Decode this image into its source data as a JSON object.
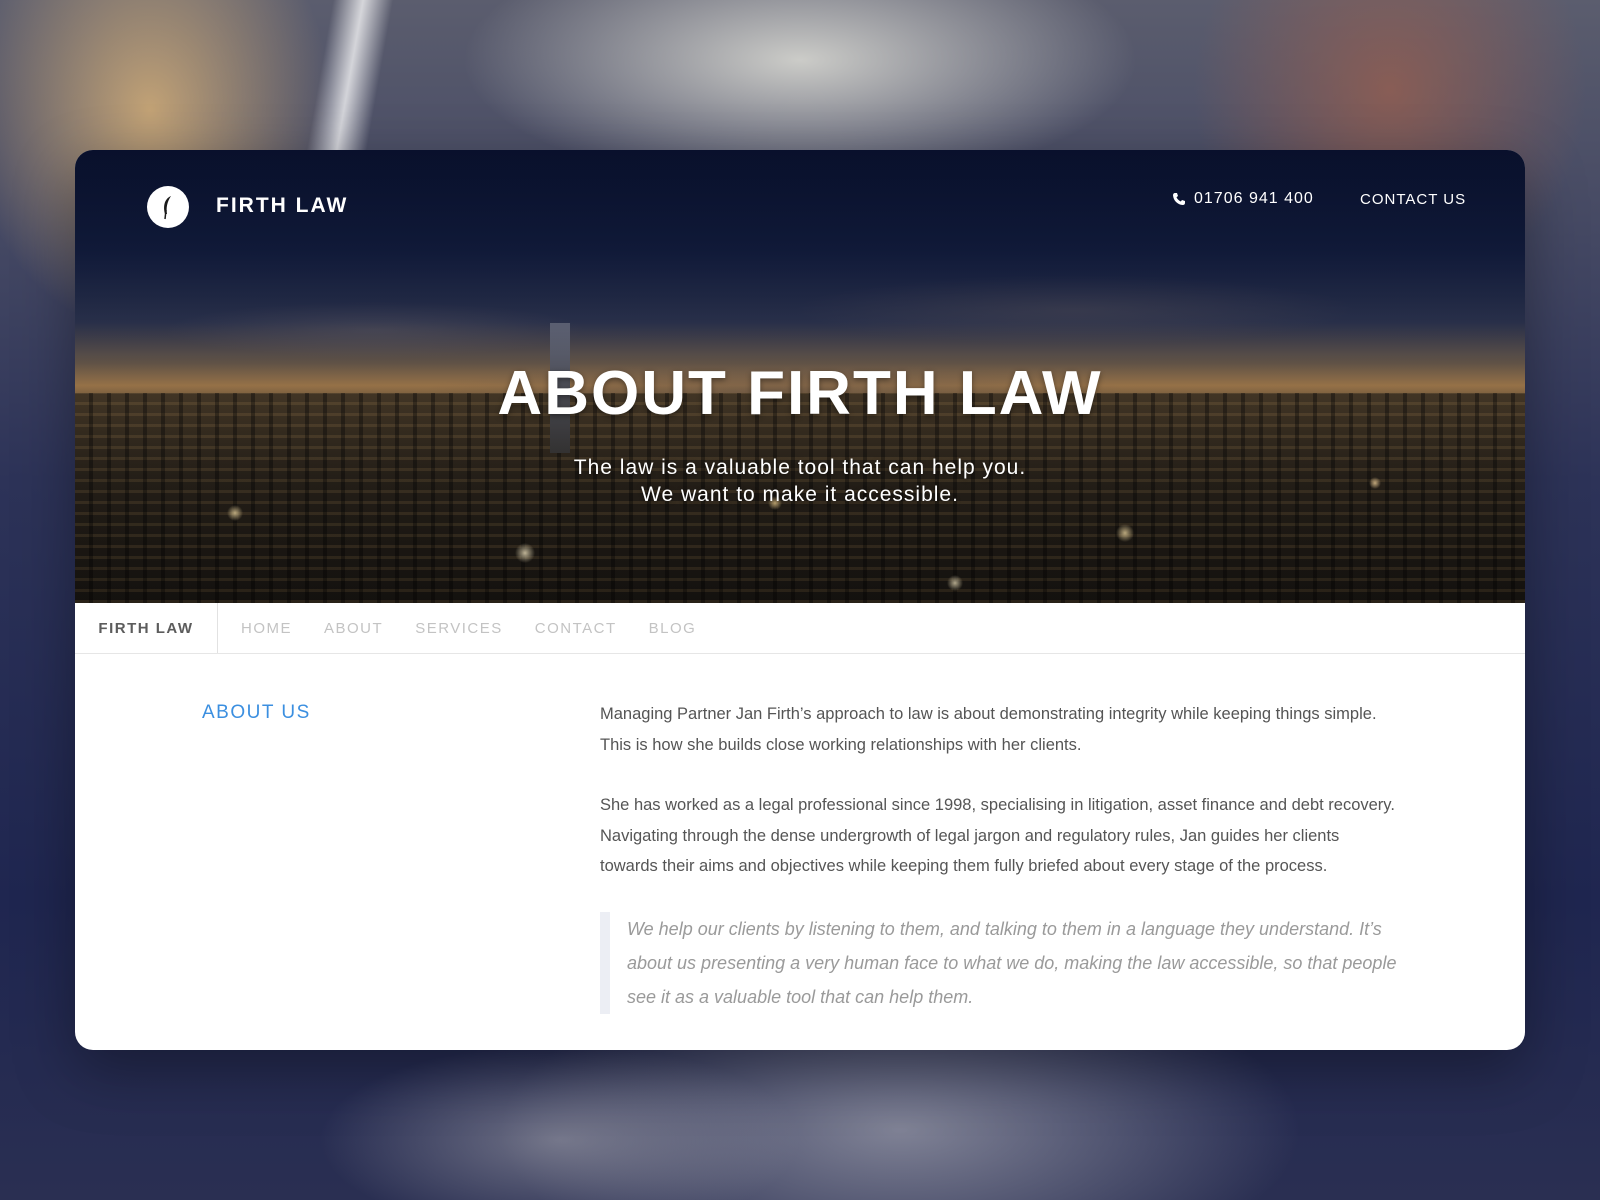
{
  "header": {
    "brand": "FIRTH LAW",
    "phone": "01706 941 400",
    "contact_link": "CONTACT US"
  },
  "hero": {
    "title": "ABOUT FIRTH LAW",
    "subtitle_line1": "The law is a valuable tool that can help you.",
    "subtitle_line2": "We want to make it accessible."
  },
  "nav": {
    "brand": "FIRTH LAW",
    "items": [
      {
        "label": "HOME"
      },
      {
        "label": "ABOUT"
      },
      {
        "label": "SERVICES"
      },
      {
        "label": "CONTACT"
      },
      {
        "label": "BLOG"
      }
    ]
  },
  "content": {
    "section_title": "ABOUT US",
    "paragraph1": "Managing Partner Jan Firth’s approach to law is about demonstrating integrity while keeping things simple. This is how she builds close working relationships with her clients.",
    "paragraph2": "She has worked as a legal professional since 1998, specialising in litigation, asset finance and debt recovery. Navigating through the dense undergrowth of legal jargon and regulatory rules, Jan guides her clients towards their aims and objectives while keeping them fully briefed about every stage of the process.",
    "quote": "We help our clients by listening to them, and talking to them in a language they understand. It’s about us presenting a very human face to what we do, making the law accessible, so that people see it as a valuable tool that can help them."
  },
  "icons": {
    "logo": "feather-logo-icon",
    "phone": "phone-icon"
  },
  "colors": {
    "accent": "#3b8fe0",
    "nav_inactive": "#c3c3c3",
    "body_text": "#555555",
    "quote_text": "#9a9a9a"
  }
}
